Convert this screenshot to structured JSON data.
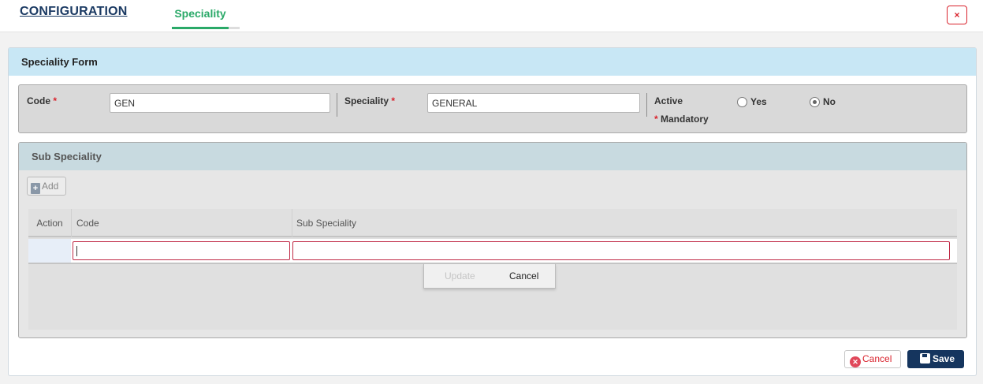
{
  "header": {
    "brand": "CONFIGURATION",
    "active_tab": "Speciality",
    "close_label": "×"
  },
  "form": {
    "title": "Speciality Form",
    "code_label": "Code",
    "code_value": "GEN",
    "speciality_label": "Speciality",
    "speciality_value": "GENERAL",
    "required_mark": "*",
    "active_label": "Active",
    "active_options": [
      "Yes",
      "No"
    ],
    "active_selected": "No",
    "mandatory_note": "Mandatory"
  },
  "sub_speciality": {
    "title": "Sub Speciality",
    "add_label": "Add",
    "columns": [
      "Action",
      "Code",
      "Sub Speciality"
    ],
    "edit_row": {
      "code": "",
      "sub_speciality": ""
    },
    "update_label": "Update",
    "cancel_label": "Cancel"
  },
  "footer": {
    "cancel_label": "Cancel",
    "save_label": "Save"
  },
  "colors": {
    "brand": "#1b3a63",
    "tab_active": "#2aa968",
    "required": "#d9232d",
    "save_button": "#15355e",
    "panel_header": "#c8e7f5"
  }
}
